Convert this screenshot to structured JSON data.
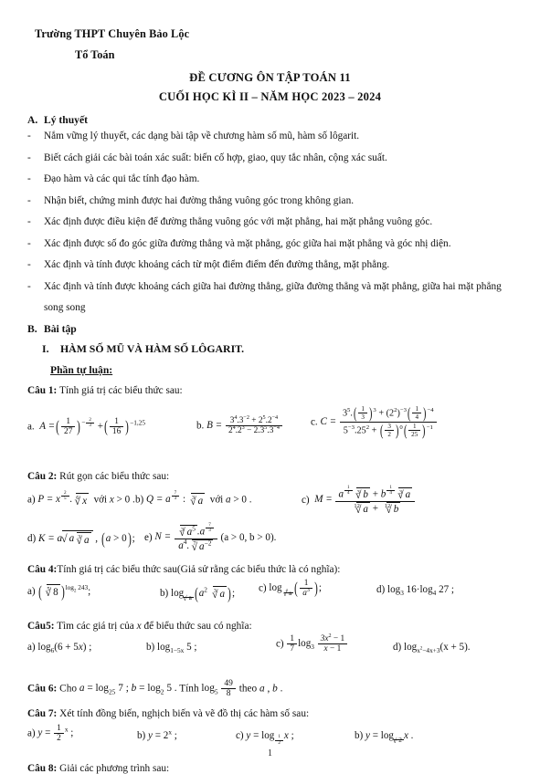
{
  "header": {
    "school": "Trường THPT Chuyên Bảo Lộc",
    "department": "Tổ Toán",
    "title_line1": "ĐỀ CƯƠNG ÔN TẬP TOÁN 11",
    "title_line2": "CUỐI HỌC KÌ II – NĂM HỌC 2023 – 2024"
  },
  "sections": {
    "a_label": "A.",
    "a_title": "Lý thuyết",
    "b_label": "B.",
    "b_title": "Bài tập",
    "roman_label": "I.",
    "roman_title": "HÀM SỐ MŨ VÀ HÀM SỐ LÔGARIT.",
    "subsection": "Phần tự luận:"
  },
  "theory_bullets": [
    "Nắm vững lý thuyết, các dạng bài tập về chương hàm số mũ, hàm số lôgarit.",
    "Biết cách giải các bài toán xác suất: biến cố hợp, giao, quy tắc nhân, cộng xác suất.",
    "Đạo hàm và các qui tắc tính đạo hàm.",
    "Nhận biết, chứng minh được hai đường thẳng vuông góc trong không gian.",
    "Xác định được điều kiện để đường thẳng vuông góc với mặt phẳng, hai mặt phẳng vuông góc.",
    "Xác định được số đo góc giữa đường thẳng và mặt phẳng, góc giữa hai mặt phẳng và góc nhị diện.",
    "Xác định và tính được khoảng cách từ một điểm điểm đến đường thẳng, mặt phẳng.",
    "Xác định và tính được khoảng cách giữa hai đường thẳng, giữa đường thẳng và mặt phẳng, giữa hai mặt phẳng song song"
  ],
  "questions": {
    "q1": {
      "label": "Câu 1:",
      "prompt": "Tính giá trị các biểu thức sau:",
      "part_a": "a.",
      "part_b": "b.",
      "part_c": "c."
    },
    "q2": {
      "label": "Câu 2:",
      "prompt": "Rút gọn các biểu thức sau:",
      "part_a": "a)",
      "part_b": "b)",
      "part_c": "c)",
      "part_d": "d)",
      "part_e": "e)",
      "cond_x": "với",
      "cond_a": "với"
    },
    "q4": {
      "label": "Câu 4:",
      "prompt": "Tính giá trị các biểu thức sau(Giả sử rằng các biểu thức là có nghĩa):",
      "part_a": "a)",
      "part_b": "b)",
      "part_c": "c)",
      "part_d": "d)"
    },
    "q5": {
      "label": "Câu5:",
      "prompt": "Tìm các giá trị của",
      "prompt2": "để biểu thức sau có nghĩa:",
      "part_a": "a)",
      "part_b": "b)",
      "part_c": "c)",
      "part_d": "d)"
    },
    "q6": {
      "label": "Câu 6:",
      "cho": "Cho",
      "tinh": "Tính",
      "theo": "theo"
    },
    "q7": {
      "label": "Câu 7:",
      "prompt": "Xét tính đồng biến, nghịch biến và vẽ đồ thị các hàm số sau:",
      "part_a": "a)",
      "part_b": "b)",
      "part_c": "c)",
      "part_d": "b)"
    },
    "q8": {
      "label": "Câu 8:",
      "prompt": "Giải các phương trình sau:"
    }
  },
  "math": {
    "q1a_expr": "A =",
    "q1b_expr": "B =",
    "q1c_expr": "C =",
    "q2a_expr": "P =",
    "q2b_expr": "Q =",
    "q2c_expr": "M =",
    "q2d_expr": "K =",
    "q2e_expr": "N ="
  },
  "footer": {
    "page_number": "1"
  }
}
